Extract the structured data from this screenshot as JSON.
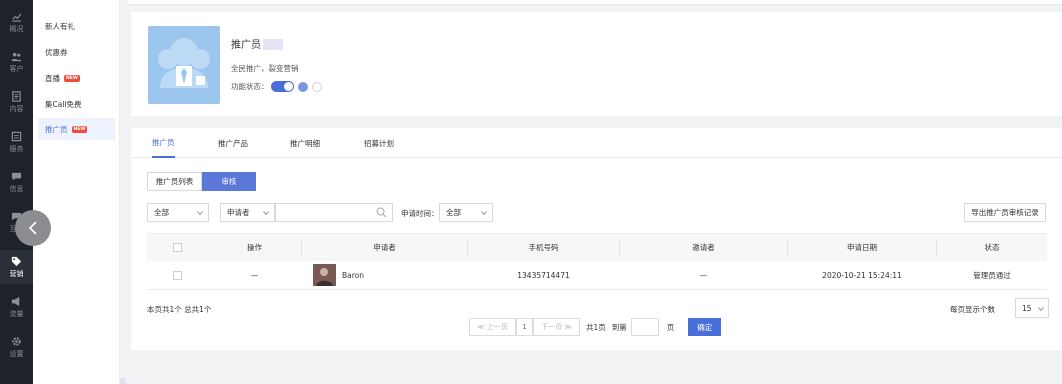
{
  "rail": {
    "items": [
      {
        "label": "概况",
        "icon": "chart-icon"
      },
      {
        "label": "客户",
        "icon": "users-icon"
      },
      {
        "label": "内容",
        "icon": "document-icon"
      },
      {
        "label": "服务",
        "icon": "service-icon"
      },
      {
        "label": "信息",
        "icon": "message-icon"
      },
      {
        "label": "互动",
        "icon": "chat-icon"
      },
      {
        "label": "营销",
        "icon": "tag-icon"
      },
      {
        "label": "流量",
        "icon": "megaphone-icon"
      },
      {
        "label": "设置",
        "icon": "gear-icon"
      }
    ],
    "active_index": 6
  },
  "submenu": {
    "items": [
      {
        "label": "新人有礼",
        "badge": ""
      },
      {
        "label": "优惠券",
        "badge": ""
      },
      {
        "label": "直播",
        "badge": "NEW"
      },
      {
        "label": "集Call免费",
        "badge": ""
      },
      {
        "label": "推广员",
        "badge": "NEW"
      }
    ],
    "active_index": 4
  },
  "feature": {
    "title": "推广员",
    "description": "全民推广，裂变营销",
    "status_label": "功能状态：",
    "enabled": true
  },
  "tabs": [
    "推广员",
    "推广产品",
    "推广明细",
    "招募计划"
  ],
  "segment": {
    "list_label": "推广员列表",
    "review_label": "审核"
  },
  "filters": {
    "status_value": "全部",
    "search_by_value": "申请者",
    "search_placeholder": "",
    "date_label": "申请时间：",
    "date_value": "全部",
    "export_label": "导出推广员审核记录"
  },
  "table": {
    "headers": [
      "操作",
      "申请者",
      "手机号码",
      "邀请者",
      "申请日期",
      "状态"
    ],
    "rows": [
      {
        "action": "—",
        "applicant": "Baron",
        "phone": "13435714471",
        "inviter": "—",
        "date": "2020-10-21 15:24:11",
        "status": "管理员通过"
      }
    ]
  },
  "summary": "本页共1个  总共1个",
  "pagination": {
    "prev": "≪ 上一页",
    "current": "1",
    "next": "下一页 ≫",
    "total_pages": "共1页",
    "goto_label": "到第",
    "page_suffix": "页",
    "confirm": "确定",
    "per_page_label": "每页显示个数",
    "per_page_value": "15"
  },
  "colors": {
    "accent": "#4a6fd8",
    "rail_bg": "#1f2329",
    "badge_red": "#ef4b3f"
  }
}
